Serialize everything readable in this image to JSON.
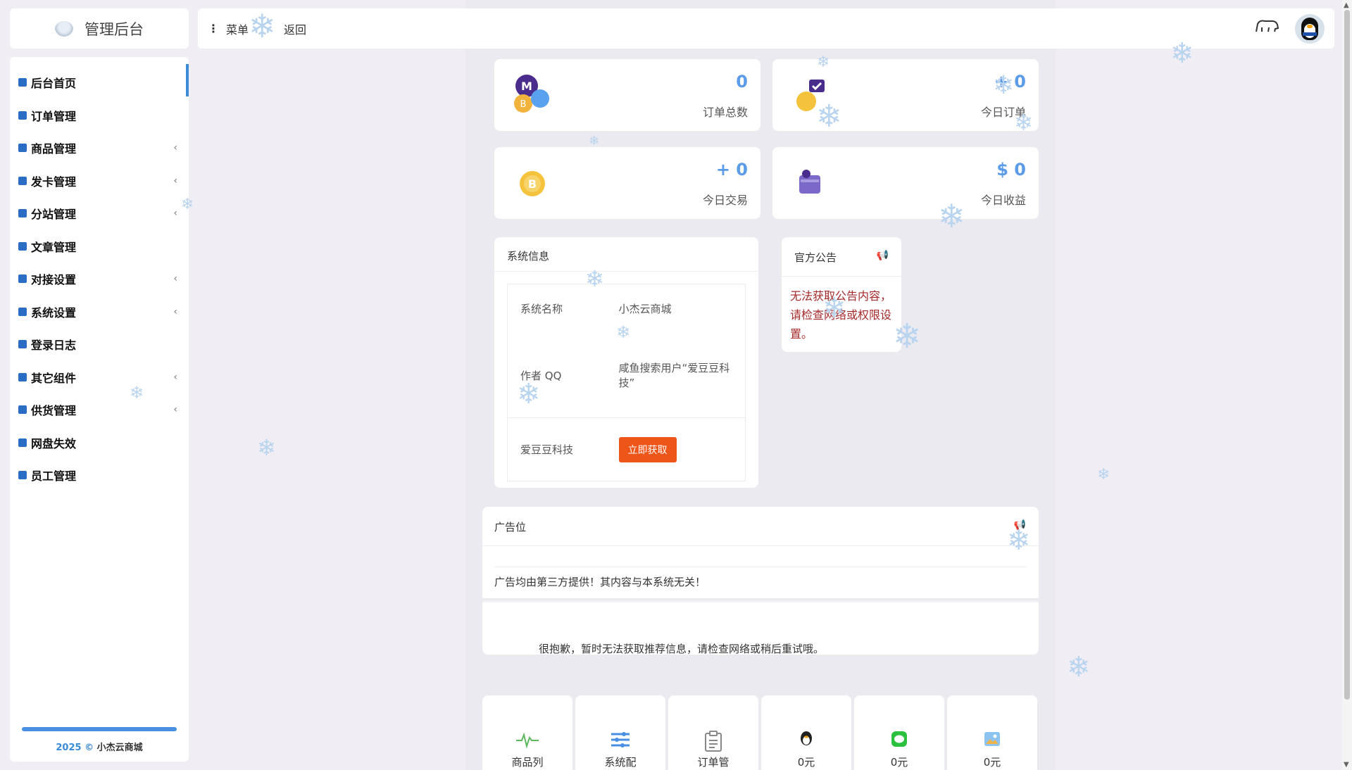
{
  "app": {
    "title": "管理后台"
  },
  "topbar": {
    "menu_label": "菜单",
    "back_label": "返回"
  },
  "sidebar": {
    "items": [
      {
        "label": "后台首页",
        "icon": "home-icon",
        "expandable": false,
        "active": true
      },
      {
        "label": "订单管理",
        "icon": "folder-icon",
        "expandable": false
      },
      {
        "label": "商品管理",
        "icon": "goods-icon",
        "expandable": true
      },
      {
        "label": "发卡管理",
        "icon": "card-icon",
        "expandable": true
      },
      {
        "label": "分站管理",
        "icon": "substation-icon",
        "expandable": true
      },
      {
        "label": "文章管理",
        "icon": "article-icon",
        "expandable": false
      },
      {
        "label": "对接设置",
        "icon": "dock-icon",
        "expandable": true
      },
      {
        "label": "系统设置",
        "icon": "settings-icon",
        "expandable": true
      },
      {
        "label": "登录日志",
        "icon": "log-icon",
        "expandable": false
      },
      {
        "label": "其它组件",
        "icon": "component-icon",
        "expandable": true
      },
      {
        "label": "供货管理",
        "icon": "supply-icon",
        "expandable": true
      },
      {
        "label": "网盘失效",
        "icon": "cloud-disk-icon",
        "expandable": false
      },
      {
        "label": "员工管理",
        "icon": "staff-icon",
        "expandable": false
      }
    ],
    "copyright_year": "2025 ©",
    "copyright_name": "小杰云商城"
  },
  "stats": [
    {
      "value": "0",
      "label": "订单总数",
      "icon": "coins-icon"
    },
    {
      "value": "+ 0",
      "label": "今日订单",
      "icon": "order-check-icon"
    },
    {
      "value": "+ 0",
      "label": "今日交易",
      "icon": "bitcoin-icon"
    },
    {
      "value": "$ 0",
      "label": "今日收益",
      "icon": "wallet-icon"
    }
  ],
  "system_info": {
    "title": "系统信息",
    "rows": [
      {
        "key": "系统名称",
        "value": "小杰云商城"
      },
      {
        "key": "作者 QQ",
        "value": "咸鱼搜索用户“爱豆豆科技”"
      },
      {
        "key": "爱豆豆科技",
        "button": "立即获取"
      }
    ]
  },
  "notice": {
    "title": "官方公告",
    "message": "无法获取公告内容，请检查网络或权限设置。",
    "colors": {
      "message": "#a52a2a"
    }
  },
  "ad": {
    "title": "广告位",
    "note": "广告均由第三方提供！其内容与本系统无关！",
    "error": "很抱歉，暂时无法获取推荐信息，请检查网络或稍后重试哦。"
  },
  "tiles": [
    {
      "label": "商品列",
      "icon": "pulse-icon"
    },
    {
      "label": "系统配",
      "icon": "sliders-icon"
    },
    {
      "label": "订单管",
      "icon": "clipboard-icon"
    },
    {
      "label": "0元",
      "icon": "qq-icon"
    },
    {
      "label": "0元",
      "icon": "wechat-icon"
    },
    {
      "label": "0元",
      "icon": "image-icon"
    }
  ],
  "colors": {
    "accent": "#3a8bd8",
    "stat_value": "#5b9be8",
    "button": "#ee5519"
  }
}
